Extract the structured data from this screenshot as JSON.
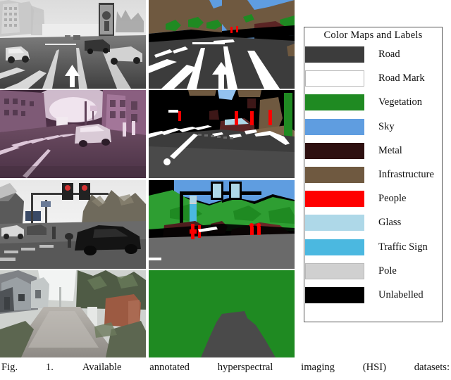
{
  "figure": {
    "caption_label": "Fig. 1.",
    "caption_text": "Available annotated hyperspectral imaging (HSI) datasets:"
  },
  "legend": {
    "title": "Color Maps and Labels",
    "entries": [
      {
        "label": "Road",
        "color": "#3c3c3c",
        "bordered": false
      },
      {
        "label": "Road Mark",
        "color": "#ffffff",
        "bordered": true
      },
      {
        "label": "Vegetation",
        "color": "#1f8a22",
        "bordered": false
      },
      {
        "label": "Sky",
        "color": "#5f9de0",
        "bordered": false
      },
      {
        "label": "Metal",
        "color": "#2e1010",
        "bordered": false
      },
      {
        "label": "Infrastructure",
        "color": "#6f5940",
        "bordered": false
      },
      {
        "label": "People",
        "color": "#fe0000",
        "bordered": false
      },
      {
        "label": "Glass",
        "color": "#aed8e8",
        "bordered": false
      },
      {
        "label": "Traffic Sign",
        "color": "#4bb8e0",
        "bordered": false
      },
      {
        "label": "Pole",
        "color": "#d0d0d0",
        "bordered": true
      },
      {
        "label": "Unlabelled",
        "color": "#000000",
        "bordered": false
      }
    ]
  },
  "grid": {
    "rows": [
      {
        "scene_name": "grayscale-boulevard-scene",
        "photo_caption": "grayscale wide boulevard with cars and billboard",
        "segmentation_caption": "segmentation of boulevard: road, road marks, infrastructure, vegetation, sky"
      },
      {
        "scene_name": "magenta-crosswalk-scene",
        "photo_caption": "magenta tinted narrow street with crosswalk and car",
        "segmentation_caption": "segmentation of crosswalk street: road, road marks, people, metal, unlabelled"
      },
      {
        "scene_name": "intersection-traffic-light-scene",
        "photo_caption": "intersection with traffic lights and dark car",
        "segmentation_caption": "segmentation of intersection: sky, vegetation, metal, people, traffic sign, pole"
      },
      {
        "scene_name": "village-lane-scene",
        "photo_caption": "narrow village lane lined with houses and trees",
        "segmentation_caption": "segmentation of village lane: vegetation and road"
      }
    ]
  }
}
